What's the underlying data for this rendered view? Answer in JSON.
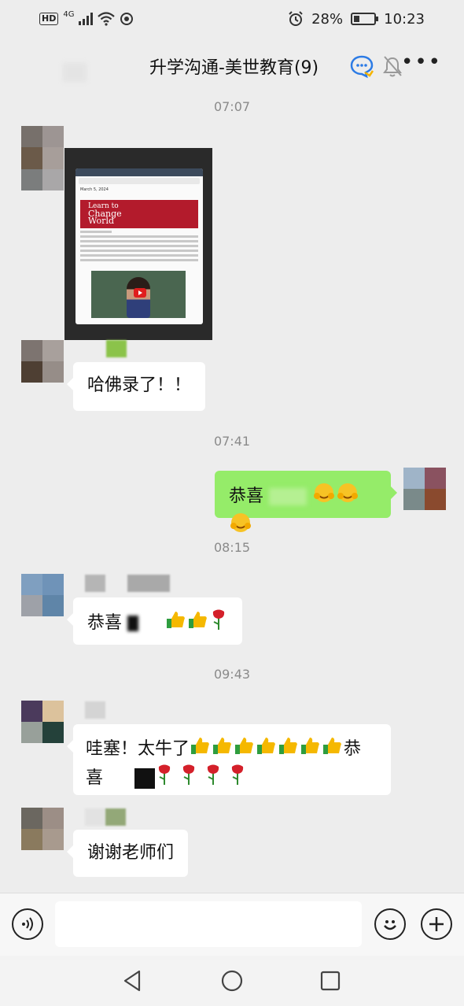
{
  "status_bar": {
    "hd": "HD",
    "network": "4G",
    "battery_percent": "28%",
    "battery_level": 0.28,
    "time": "10:23"
  },
  "header": {
    "title": "升学沟通-美世教育(9)",
    "icons": [
      "chat-bubble-icon",
      "mute-bell-icon",
      "more-icon"
    ],
    "more_label": "•••"
  },
  "messages": [
    {
      "type": "time",
      "text": "07:07"
    },
    {
      "type": "image",
      "side": "left",
      "description_icon": "screenshot-image",
      "screen_text": {
        "banner_line1": "Learn to",
        "banner_line2": "Change",
        "banner_line3": "World",
        "date": "March 5, 2024"
      }
    },
    {
      "type": "text",
      "side": "left",
      "text": "哈佛录了！！"
    },
    {
      "type": "time",
      "text": "07:41"
    },
    {
      "type": "text",
      "side": "right",
      "text": "恭喜",
      "emoji": [
        "hug-emoji",
        "hug-emoji",
        "hug-emoji"
      ]
    },
    {
      "type": "time",
      "text": "08:15"
    },
    {
      "type": "text",
      "side": "left",
      "text": "恭喜",
      "emoji": [
        "thumbs-up-emoji",
        "thumbs-up-emoji",
        "rose-emoji"
      ]
    },
    {
      "type": "time",
      "text": "09:43"
    },
    {
      "type": "text",
      "side": "left",
      "text": "哇塞！太牛了",
      "text_tail": "恭",
      "text_line2": "喜",
      "emoji": [
        "thumbs-up-emoji",
        "thumbs-up-emoji",
        "thumbs-up-emoji",
        "thumbs-up-emoji",
        "thumbs-up-emoji",
        "thumbs-up-emoji",
        "thumbs-up-emoji"
      ],
      "emoji_line2": [
        "rose-emoji",
        "rose-emoji",
        "rose-emoji",
        "rose-emoji"
      ]
    },
    {
      "type": "text",
      "side": "left",
      "text": "谢谢老师们"
    }
  ],
  "input_bar": {
    "placeholder": "",
    "icons": [
      "voice-icon",
      "emoji-icon",
      "plus-icon"
    ]
  },
  "nav_bar": {
    "icons": [
      "back-nav-icon",
      "home-nav-icon",
      "recents-nav-icon"
    ]
  },
  "colors": {
    "background": "#ededed",
    "bubble_self": "#95ec69",
    "bubble_other": "#ffffff",
    "time_text": "#8a8a8a"
  }
}
